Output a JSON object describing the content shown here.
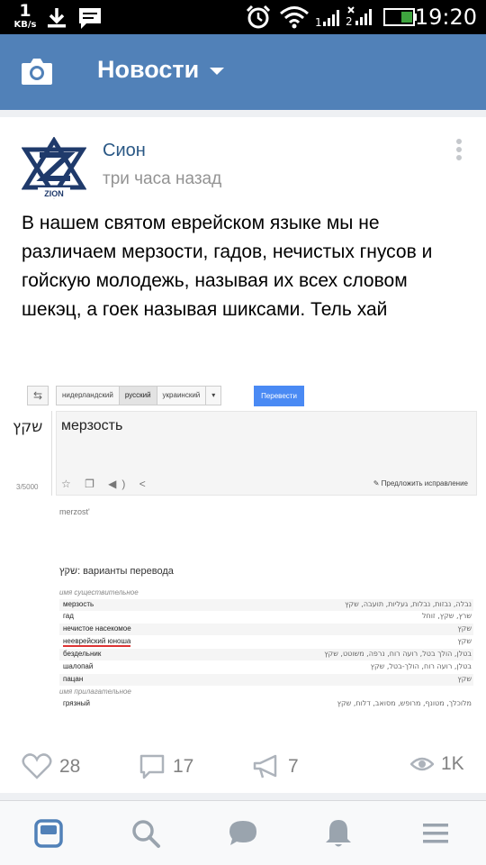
{
  "status_bar": {
    "speed_value": "1",
    "speed_unit": "KB/s",
    "time": "19:20"
  },
  "header": {
    "title": "Новости",
    "camera_icon": "camera-icon",
    "dropdown_icon": "caret-down-icon"
  },
  "post": {
    "author": "Сион",
    "time": "три часа назад",
    "avatar_text": "ZION",
    "text": "В нашем святом еврейском языке мы не различаем мерзости, гадов, нечистых гнусов и гойскую молодежь, называя их всех словом шекэц, а гоек называя шиксами. Тель хай"
  },
  "screenshot": {
    "langs": [
      "нидерландский",
      "русский",
      "украинский",
      "▾"
    ],
    "translate_button": "Перевести",
    "source_word": "שקץ",
    "char_count": "3/5000",
    "result_word": "мерзость",
    "tools": "☆ ❐ ◀) <",
    "suggest": "✎ Предложить исправление",
    "transliteration": "merzost'",
    "variants_title": "שקץ: варианты перевода",
    "pos_noun": "имя существительное",
    "noun_rows": [
      {
        "ru": "мерзость",
        "he": "נבלה, נבזות, נבלות, געליות, תועבה, שקץ"
      },
      {
        "ru": "гад",
        "he": "שרץ, שקץ, זוחל"
      },
      {
        "ru": "нечистое насекомое",
        "he": "שקץ"
      },
      {
        "ru": "нееврейский юноша",
        "he": "שקץ"
      },
      {
        "ru": "бездельник",
        "he": "בטלן, הולך בטל, רועה רוח, נרפה, משוטט, שקץ"
      },
      {
        "ru": "шалопай",
        "he": "בטלן, רועה רוח, הולך-בטל, שקץ"
      },
      {
        "ru": "пацан",
        "he": "שקץ"
      }
    ],
    "pos_adj": "имя прилагательное",
    "adj_rows": [
      {
        "ru": "грязный",
        "he": "מלוכלך, מטונף, מרופש, מסואב, דלוח, שקץ"
      }
    ]
  },
  "actions": {
    "likes": "28",
    "comments": "17",
    "reposts": "7",
    "views": "1K"
  },
  "colors": {
    "header_bg": "#5181b8",
    "link": "#2a5885",
    "muted": "#939393"
  }
}
